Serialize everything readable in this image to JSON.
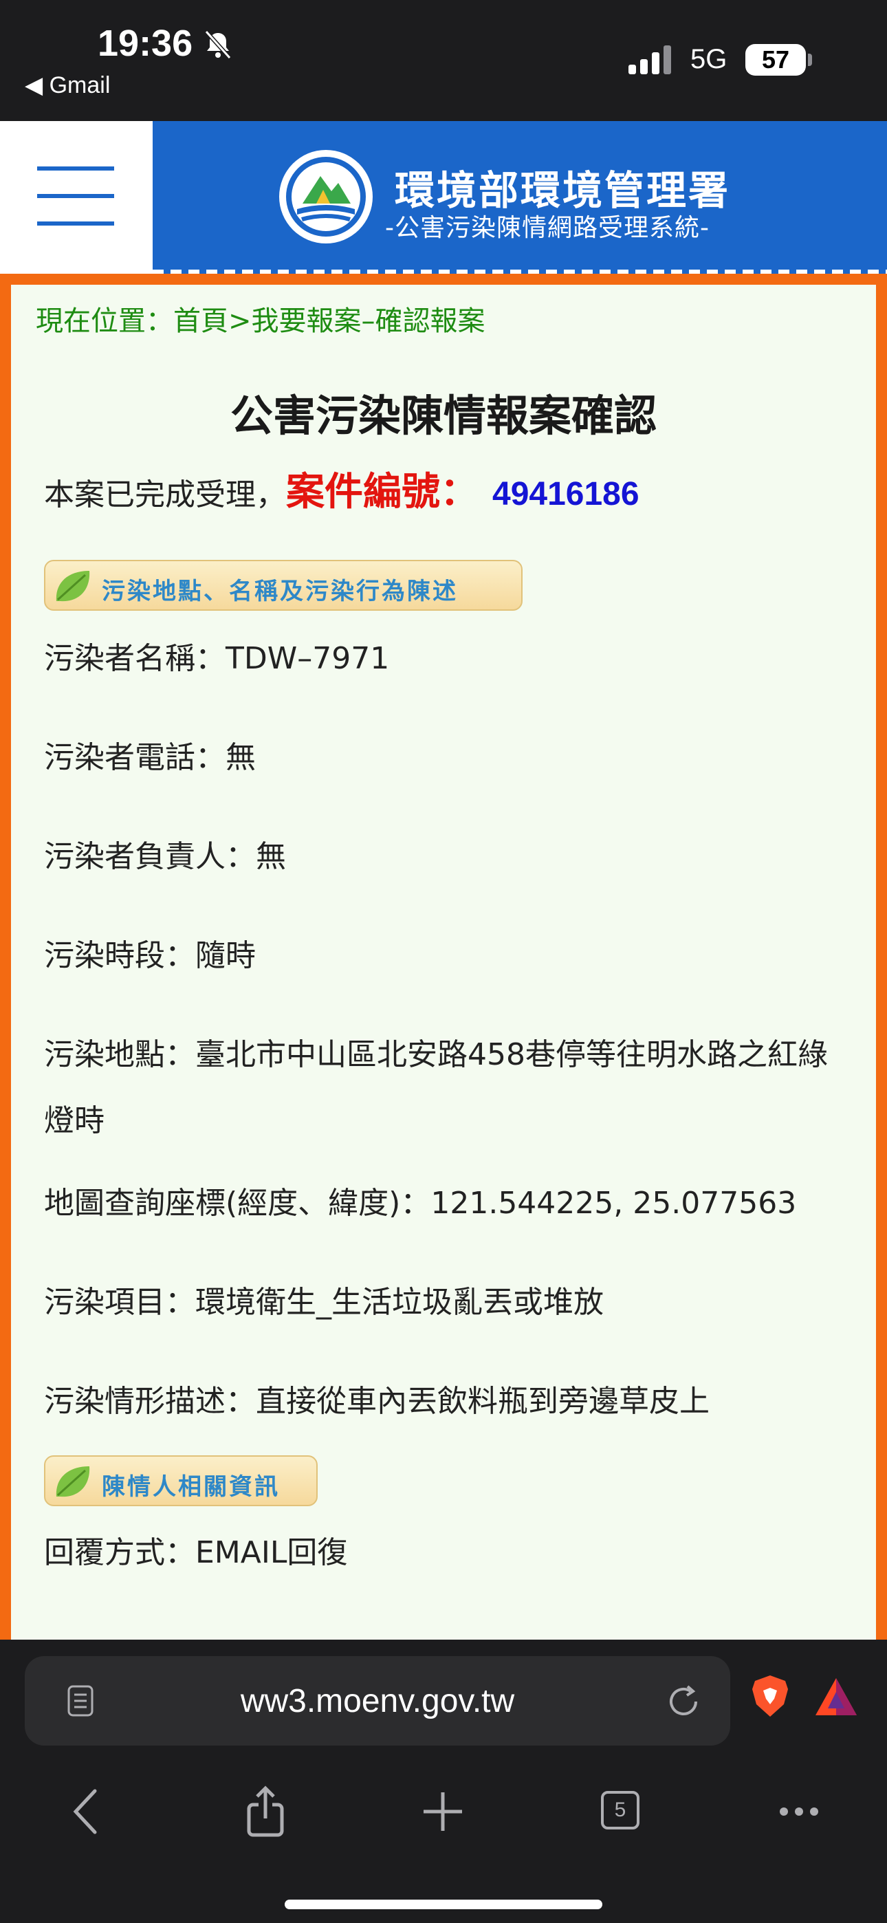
{
  "status_bar": {
    "time": "19:36",
    "back_app": "◀ Gmail",
    "network": "5G",
    "battery": "57"
  },
  "header": {
    "agency_name": "環境部環境管理署",
    "system_name": "-公害污染陳情網路受理系統-"
  },
  "breadcrumb": "現在位置：首頁>我要報案–確認報案",
  "page_title": "公害污染陳情報案確認",
  "case": {
    "prefix": "本案已完成受理，",
    "label": "案件編號：",
    "number": "49416186"
  },
  "sections": {
    "pollution": "污染地點、名稱及污染行為陳述",
    "reporter": "陳情人相關資訊"
  },
  "fields": {
    "polluter_name": {
      "label": "污染者名稱：",
      "value": "TDW–7971"
    },
    "polluter_phone": {
      "label": "污染者電話：",
      "value": "無"
    },
    "polluter_owner": {
      "label": "污染者負責人：",
      "value": "無"
    },
    "pollution_time": {
      "label": "污染時段：",
      "value": "隨時"
    },
    "pollution_location": {
      "label": "污染地點：",
      "value": "臺北市中山區北安路458巷停等往明水路之紅綠燈時"
    },
    "map_coords": {
      "label": "地圖查詢座標(經度、緯度)：",
      "value": "121.544225, 25.077563"
    },
    "pollution_item": {
      "label": "污染項目：",
      "value": "環境衛生_生活垃圾亂丟或堆放"
    },
    "pollution_desc": {
      "label": "污染情形描述：",
      "value": "直接從車內丟飲料瓶到旁邊草皮上"
    },
    "reply_method": {
      "label": "回覆方式：",
      "value": "EMAIL回復"
    }
  },
  "browser": {
    "url": "ww3.moenv.gov.tw",
    "tab_count": "5"
  },
  "colors": {
    "header_blue": "#1b66c9",
    "frame_orange": "#f36a12",
    "breadcrumb_green": "#1e8c12",
    "case_red": "#e3150f",
    "case_number_blue": "#1414d4"
  }
}
